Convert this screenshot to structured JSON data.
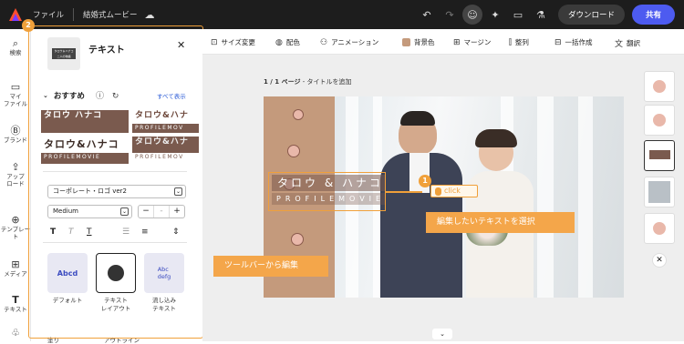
{
  "topbar": {
    "file_label": "ファイル",
    "doc_title": "結婚式ムービー",
    "download_label": "ダウンロード",
    "share_label": "共有",
    "share_color": "#4d5bf0"
  },
  "leftnav": [
    {
      "label": "検索",
      "icon": "search-icon"
    },
    {
      "label": "マイ\nファイル",
      "icon": "folder-icon"
    },
    {
      "label": "ブランド",
      "icon": "brand-icon"
    },
    {
      "label": "アップ\nロード",
      "icon": "upload-icon"
    },
    {
      "label": "テンプレート",
      "icon": "template-icon"
    },
    {
      "label": "メディア",
      "icon": "media-icon"
    },
    {
      "label": "テキスト",
      "icon": "text-icon"
    },
    {
      "label": "",
      "icon": "shapes-icon"
    }
  ],
  "panel": {
    "step_badge": "2",
    "thumb_line1": "タロウ＆ハナコ",
    "thumb_line2": "二人の物語",
    "title": "テキスト",
    "recommended": "おすすめ",
    "show_all": "すべて表示",
    "presets": [
      {
        "line1": "タロウ ハナコ",
        "line2": ""
      },
      {
        "line1": "タロウ&ハナ",
        "line2": "PROFILEMOV"
      },
      {
        "line1": "タロウ&ハナコ",
        "line2": "PROFILEMOVIE"
      },
      {
        "line1": "タロウ&ハナ",
        "line2": "PROFILEMOV"
      }
    ],
    "font_select": "コーポレート・ロゴ ver2",
    "weight_select": "Medium",
    "layouts": [
      {
        "label": "デフォルト",
        "icon_text": "Abcd"
      },
      {
        "label": "テキスト\nレイアウト",
        "icon_text": ""
      },
      {
        "label": "流し込み\nテキスト",
        "icon_text": "Abc\ndefg"
      }
    ],
    "bottom_left": "塗り",
    "bottom_right": "アウトライン"
  },
  "toolbar": {
    "items": [
      {
        "label": "サイズ変更",
        "icon": "resize-icon"
      },
      {
        "label": "配色",
        "icon": "palette-icon"
      },
      {
        "label": "アニメーション",
        "icon": "animation-icon"
      },
      {
        "label": "背景色",
        "icon": "bg-color-icon"
      },
      {
        "label": "マージン",
        "icon": "margin-icon"
      },
      {
        "label": "整列",
        "icon": "align-icon"
      },
      {
        "label": "一括作成",
        "icon": "bulk-create-icon"
      },
      {
        "label": "翻訳",
        "icon": "translate-icon"
      }
    ]
  },
  "canvas": {
    "page_num": "1 / 1 ページ",
    "page_sep": " - ",
    "page_title_placeholder": "タイトルを追加",
    "title_main": "タロウ & ハナコ",
    "title_sub": "PROFILEMOVIE",
    "badge_num": "1",
    "click_label": "click",
    "callout_select": "編集したいテキストを選択",
    "callout_toolbar": "ツールバーから編集",
    "accent": "#f0a03a",
    "beige": "#c49a7c"
  }
}
